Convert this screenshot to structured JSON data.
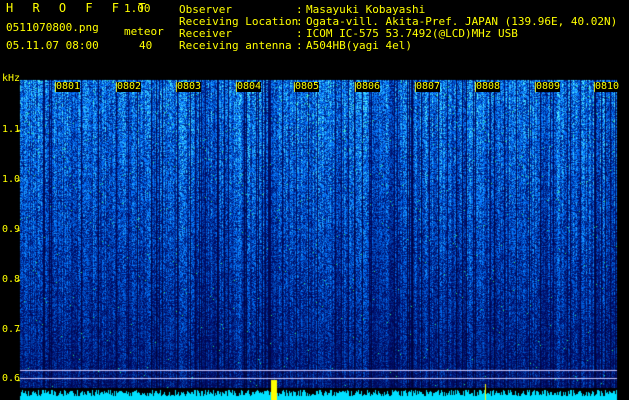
{
  "header": {
    "app_title": "H R O F F T",
    "app_version": "1.00",
    "file_name": "0511070800.png",
    "meteor_label": "meteor",
    "date_time": "05.11.07 08:00",
    "meteor_count": "40"
  },
  "info": [
    {
      "label": "Observer",
      "colon": ":",
      "value": "Masayuki Kobayashi"
    },
    {
      "label": "Receiving Location",
      "colon": ":",
      "value": "Ogata-vill. Akita-Pref. JAPAN (139.96E, 40.02N)"
    },
    {
      "label": "Receiver",
      "colon": ":",
      "value": "ICOM IC-575 53.7492(@LCD)MHz USB"
    },
    {
      "label": "Receiving antenna",
      "colon": ":",
      "value": "A504HB(yagi 4el)"
    }
  ],
  "spectrogram": {
    "y_unit": "kHz",
    "y_ticks": [
      "1.1",
      "1.0",
      "0.9",
      "0.8",
      "0.7",
      "0.6"
    ],
    "x_ticks": [
      "0801",
      "0802",
      "0803",
      "0804",
      "0805",
      "0806",
      "0807",
      "0808",
      "0809",
      "0810"
    ]
  },
  "colors": {
    "background": "#000000",
    "text_yellow": "#ffff00",
    "text_green": "#00e000",
    "spectrum_dark": "#001060",
    "spectrum_blue": "#0060ff",
    "spectrum_cyan": "#00e0ff",
    "baseline_line": "#c8c8ff"
  }
}
